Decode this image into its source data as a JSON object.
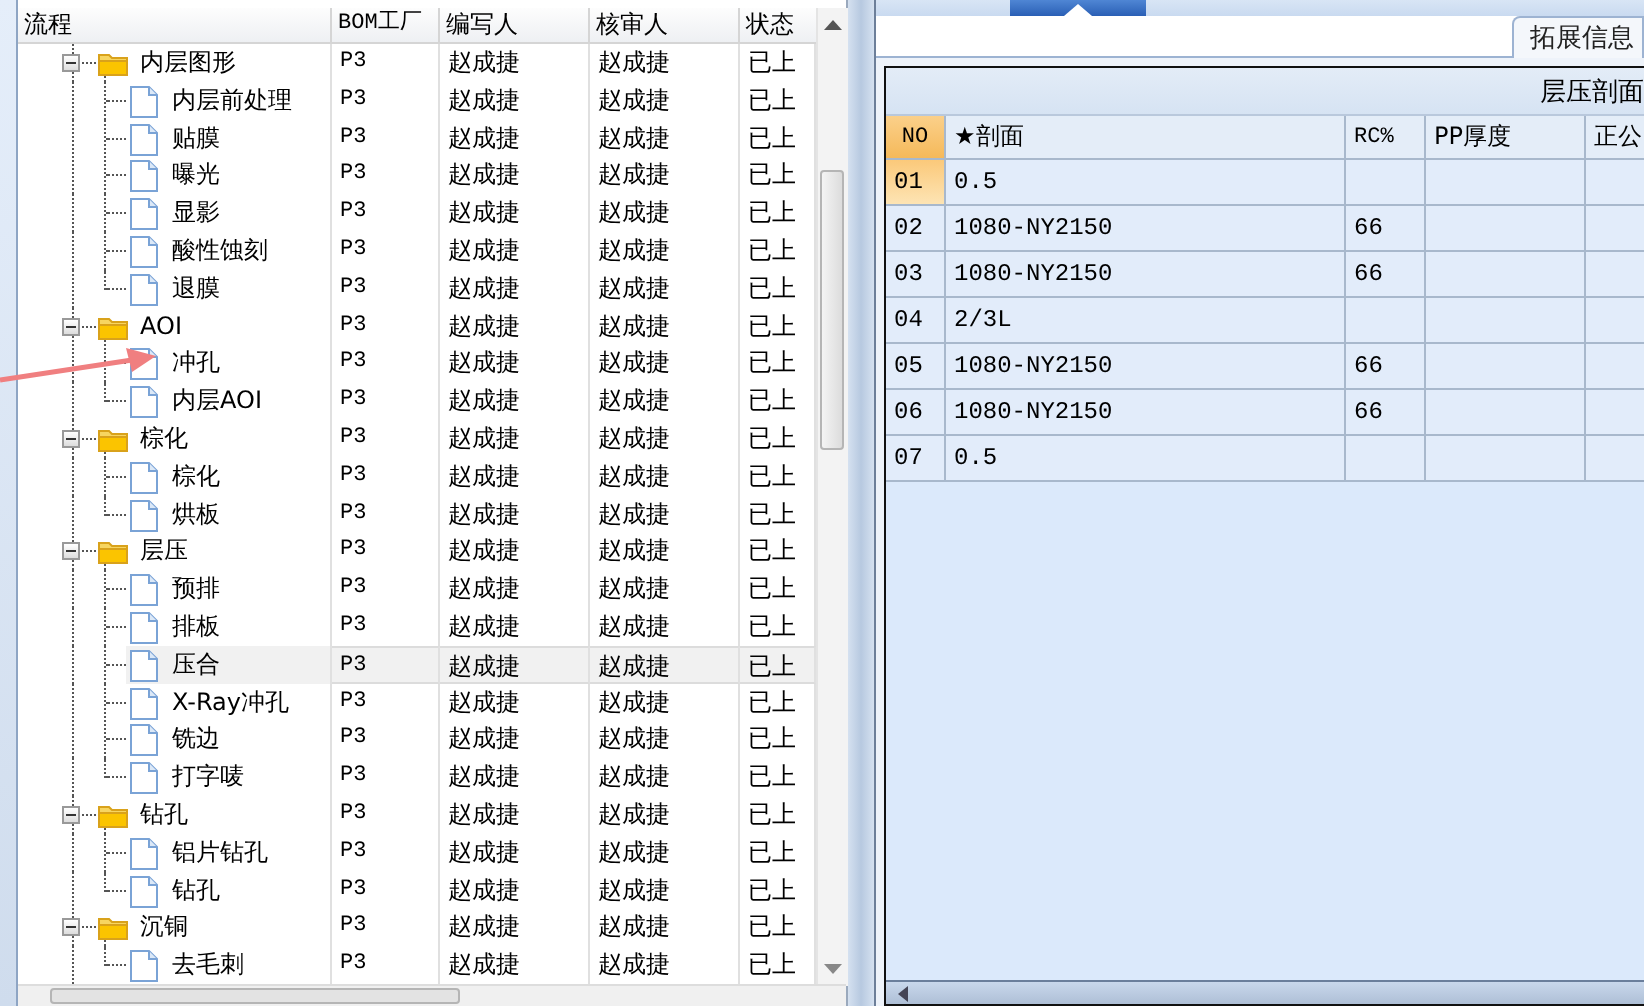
{
  "process_grid": {
    "columns": [
      "流程",
      "BOM工厂",
      "编写人",
      "核审人",
      "状态"
    ],
    "tree": [
      {
        "label": "内层图形",
        "bom": "P3",
        "writer": "赵成捷",
        "reviewer": "赵成捷",
        "status": "已上",
        "expanded": true,
        "selected": false,
        "children": [
          {
            "label": "内层前处理",
            "bom": "P3",
            "writer": "赵成捷",
            "reviewer": "赵成捷",
            "status": "已上",
            "selected": false
          },
          {
            "label": "贴膜",
            "bom": "P3",
            "writer": "赵成捷",
            "reviewer": "赵成捷",
            "status": "已上",
            "selected": false
          },
          {
            "label": "曝光",
            "bom": "P3",
            "writer": "赵成捷",
            "reviewer": "赵成捷",
            "status": "已上",
            "selected": false
          },
          {
            "label": "显影",
            "bom": "P3",
            "writer": "赵成捷",
            "reviewer": "赵成捷",
            "status": "已上",
            "selected": false
          },
          {
            "label": "酸性蚀刻",
            "bom": "P3",
            "writer": "赵成捷",
            "reviewer": "赵成捷",
            "status": "已上",
            "selected": false
          },
          {
            "label": "退膜",
            "bom": "P3",
            "writer": "赵成捷",
            "reviewer": "赵成捷",
            "status": "已上",
            "selected": false
          }
        ]
      },
      {
        "label": "AOI",
        "bom": "P3",
        "writer": "赵成捷",
        "reviewer": "赵成捷",
        "status": "已上",
        "expanded": true,
        "selected": false,
        "children": [
          {
            "label": "冲孔",
            "bom": "P3",
            "writer": "赵成捷",
            "reviewer": "赵成捷",
            "status": "已上",
            "selected": false
          },
          {
            "label": "内层AOI",
            "bom": "P3",
            "writer": "赵成捷",
            "reviewer": "赵成捷",
            "status": "已上",
            "selected": false
          }
        ]
      },
      {
        "label": "棕化",
        "bom": "P3",
        "writer": "赵成捷",
        "reviewer": "赵成捷",
        "status": "已上",
        "expanded": true,
        "selected": false,
        "children": [
          {
            "label": "棕化",
            "bom": "P3",
            "writer": "赵成捷",
            "reviewer": "赵成捷",
            "status": "已上",
            "selected": false
          },
          {
            "label": "烘板",
            "bom": "P3",
            "writer": "赵成捷",
            "reviewer": "赵成捷",
            "status": "已上",
            "selected": false
          }
        ]
      },
      {
        "label": "层压",
        "bom": "P3",
        "writer": "赵成捷",
        "reviewer": "赵成捷",
        "status": "已上",
        "expanded": true,
        "selected": false,
        "children": [
          {
            "label": "预排",
            "bom": "P3",
            "writer": "赵成捷",
            "reviewer": "赵成捷",
            "status": "已上",
            "selected": false
          },
          {
            "label": "排板",
            "bom": "P3",
            "writer": "赵成捷",
            "reviewer": "赵成捷",
            "status": "已上",
            "selected": false
          },
          {
            "label": "压合",
            "bom": "P3",
            "writer": "赵成捷",
            "reviewer": "赵成捷",
            "status": "已上",
            "selected": true
          },
          {
            "label": "X-Ray冲孔",
            "bom": "P3",
            "writer": "赵成捷",
            "reviewer": "赵成捷",
            "status": "已上",
            "selected": false
          },
          {
            "label": "铣边",
            "bom": "P3",
            "writer": "赵成捷",
            "reviewer": "赵成捷",
            "status": "已上",
            "selected": false
          },
          {
            "label": "打字唛",
            "bom": "P3",
            "writer": "赵成捷",
            "reviewer": "赵成捷",
            "status": "已上",
            "selected": false
          }
        ]
      },
      {
        "label": "钻孔",
        "bom": "P3",
        "writer": "赵成捷",
        "reviewer": "赵成捷",
        "status": "已上",
        "expanded": true,
        "selected": false,
        "children": [
          {
            "label": "铝片钻孔",
            "bom": "P3",
            "writer": "赵成捷",
            "reviewer": "赵成捷",
            "status": "已上",
            "selected": false
          },
          {
            "label": "钻孔",
            "bom": "P3",
            "writer": "赵成捷",
            "reviewer": "赵成捷",
            "status": "已上",
            "selected": false
          }
        ]
      },
      {
        "label": "沉铜",
        "bom": "P3",
        "writer": "赵成捷",
        "reviewer": "赵成捷",
        "status": "已上",
        "expanded": true,
        "selected": false,
        "children": [
          {
            "label": "去毛刺",
            "bom": "P3",
            "writer": "赵成捷",
            "reviewer": "赵成捷",
            "status": "已上",
            "selected": false
          }
        ]
      }
    ]
  },
  "extension_tab": {
    "label": "拓展信息"
  },
  "lamination_table": {
    "title": "层压剖面",
    "columns": [
      "NO",
      "★剖面",
      "RC%",
      "PP厚度",
      "正公"
    ],
    "rows": [
      {
        "no": "01",
        "profile": "0.5",
        "rc": "",
        "pp": "",
        "selected": true
      },
      {
        "no": "02",
        "profile": "1080-NY2150",
        "rc": "66",
        "pp": "",
        "selected": false
      },
      {
        "no": "03",
        "profile": "1080-NY2150",
        "rc": "66",
        "pp": "",
        "selected": false
      },
      {
        "no": "04",
        "profile": "2/3L",
        "rc": "",
        "pp": "",
        "selected": false
      },
      {
        "no": "05",
        "profile": "1080-NY2150",
        "rc": "66",
        "pp": "",
        "selected": false
      },
      {
        "no": "06",
        "profile": "1080-NY2150",
        "rc": "66",
        "pp": "",
        "selected": false
      },
      {
        "no": "07",
        "profile": "0.5",
        "rc": "",
        "pp": "",
        "selected": false
      }
    ]
  }
}
